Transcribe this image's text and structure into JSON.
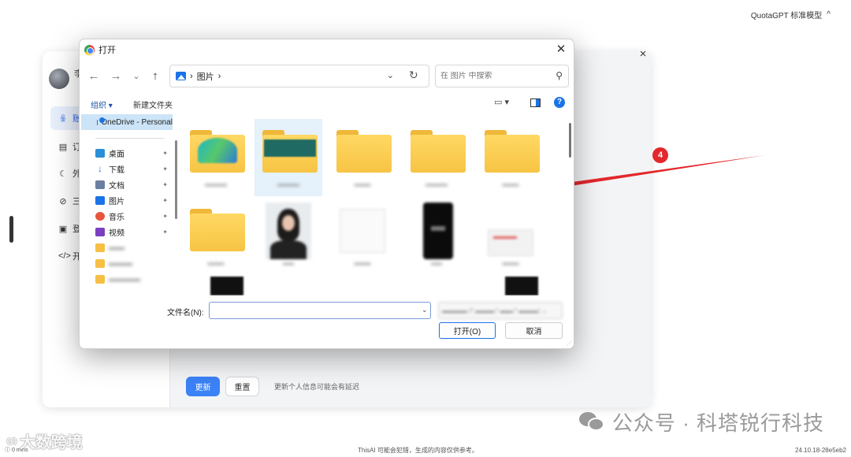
{
  "app": {
    "model_label": "QuotaGPT 标准模型",
    "panel_avatar_char": "李",
    "nav_items": [
      {
        "icon": "person",
        "label": "账"
      },
      {
        "icon": "doc",
        "label": "订"
      },
      {
        "icon": "moon",
        "label": "外"
      },
      {
        "icon": "link",
        "label": "三"
      },
      {
        "icon": "window",
        "label": "登"
      },
      {
        "icon": "code",
        "label": "开"
      }
    ],
    "update_button": "更新",
    "reset_button": "重置",
    "update_note": "更新个人信息可能会有延迟",
    "footer_left": "0 mins",
    "footer_middle": "ThisAI 可能会犯错，生成的内容仅供参考。",
    "footer_right": "24.10.18-28e5eb2"
  },
  "annotation": {
    "badge": "4",
    "color": "#e3272b"
  },
  "watermarks": {
    "left": "大数跨境",
    "right": "公众号 · 科塔锐行科技"
  },
  "dialog": {
    "title": "打开",
    "address": {
      "separator": "›",
      "folder": "图片",
      "trail": "›"
    },
    "search_placeholder": "在 图片 中搜索",
    "toolbar": {
      "organize": "组织 ▾",
      "new_folder": "新建文件夹",
      "help": "?"
    },
    "nav": {
      "onedrive": "OneDrive - Personal",
      "quick_access": [
        {
          "icon": "desk",
          "label": "桌面"
        },
        {
          "icon": "down",
          "label": "下载"
        },
        {
          "icon": "doc",
          "label": "文档"
        },
        {
          "icon": "pic",
          "label": "图片"
        },
        {
          "icon": "music",
          "label": "音乐"
        },
        {
          "icon": "video",
          "label": "视频"
        }
      ]
    },
    "filename_label": "文件名(N):",
    "filename_value": "",
    "open_button": "打开(O)",
    "cancel_button": "取消"
  }
}
